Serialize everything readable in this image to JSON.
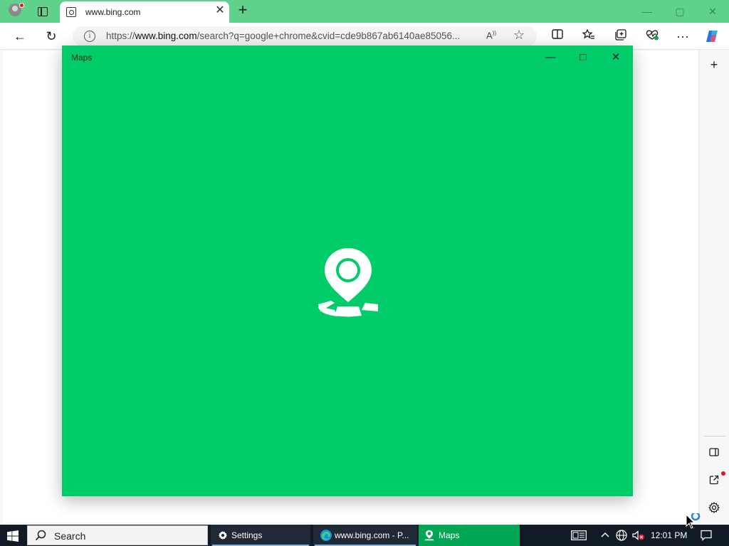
{
  "browser": {
    "tab": {
      "title": "www.bing.com",
      "close_glyph": "✕"
    },
    "new_tab_glyph": "+",
    "window_controls": {
      "minimize": "—",
      "maximize": "▢",
      "close": "✕"
    },
    "address_bar": {
      "url_prefix": "https://",
      "url_host": "www.bing.com",
      "url_rest": "/search?q=google+chrome&cvid=cde9b867ab6140ae85056...",
      "read_aloud_glyph": "A",
      "favorite_glyph": "☆"
    },
    "nav": {
      "back_glyph": "←",
      "refresh_glyph": "↻"
    },
    "toolbar": {
      "more_glyph": "···"
    },
    "sidebar": {
      "add_glyph": "+"
    }
  },
  "maps_window": {
    "title": "Maps",
    "minimize": "—",
    "maximize": "□",
    "close": "✕",
    "background_color": "#00cc6a",
    "logo_icon": "maps-pin-icon"
  },
  "taskbar": {
    "search_label": "Search",
    "items": [
      {
        "label": "Settings",
        "icon": "gear-icon"
      },
      {
        "label": "www.bing.com - P...",
        "icon": "edge-icon"
      },
      {
        "label": "Maps",
        "icon": "maps-icon"
      }
    ],
    "time": "12:01 PM"
  }
}
